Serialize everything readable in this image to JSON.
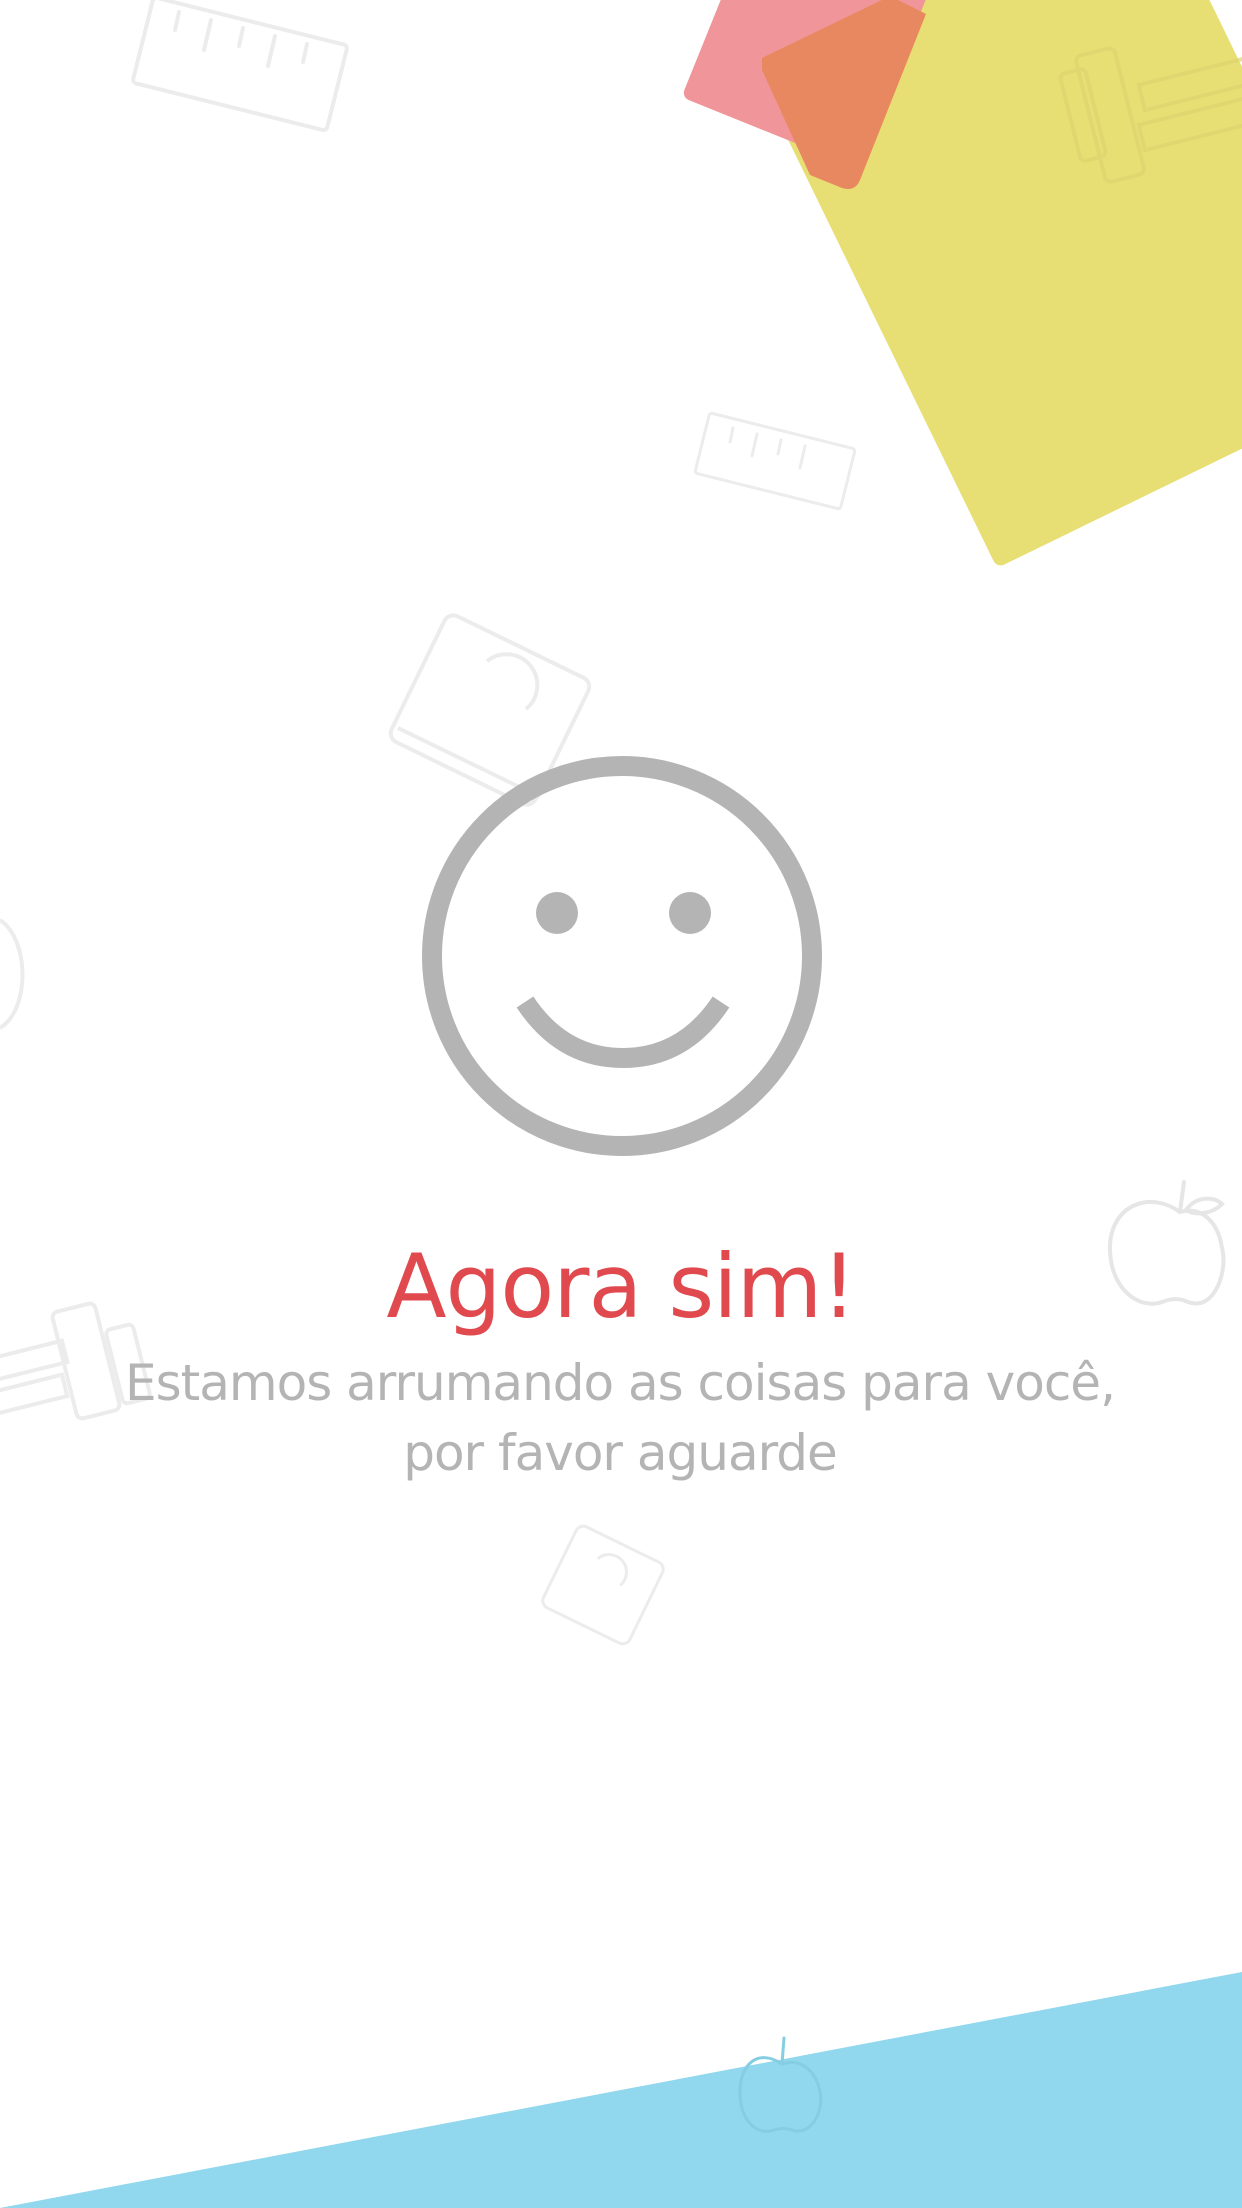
{
  "screen": {
    "title": "Agora sim!",
    "subtitle_line1": "Estamos arrumando as coisas para você,",
    "subtitle_line2": "por favor aguarde"
  },
  "icons": {
    "main": "smiley-face-icon",
    "background": [
      "ruler-icon",
      "dumbbell-icon",
      "scale-icon",
      "apple-icon"
    ]
  },
  "colors": {
    "background": "#ffffff",
    "title": "#e04a4f",
    "subtitle": "#b4b4b4",
    "smiley": "#b4b4b4",
    "pink_shape": "#f0959a",
    "orange_shape": "#e88860",
    "yellow_shape": "#e8df74",
    "blue_shape": "#91d7ed",
    "doodle": "#ececec"
  }
}
